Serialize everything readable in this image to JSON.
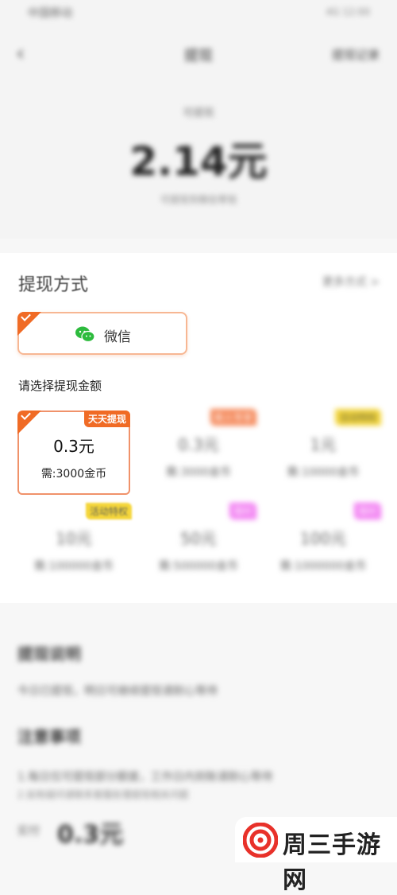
{
  "status_bar": {
    "left": "中国移动",
    "right": "4G 12:00"
  },
  "nav": {
    "back_icon": "chevron-left-icon",
    "title": "提现",
    "right": "提现记录"
  },
  "balance": {
    "label": "可提现",
    "amount": "2.14元",
    "note": "可提现到微信零钱"
  },
  "method_section": {
    "title": "提现方式",
    "right_link": "更多方式 >",
    "selected_method": "微信",
    "method_icon": "wechat-icon"
  },
  "amount_section": {
    "title": "请选择提现金额",
    "options": [
      {
        "amount": "0.3元",
        "need": "需:3000金币",
        "badge": "天天提现",
        "selected": true
      },
      {
        "amount": "0.3元",
        "need": "需:3000金币",
        "badge": "新人专享",
        "selected": false
      },
      {
        "amount": "1元",
        "need": "需:10000金币",
        "badge": "活动特权",
        "selected": false
      },
      {
        "amount": "10元",
        "need": "需:100000金币",
        "badge": "活动特权",
        "selected": false
      },
      {
        "amount": "50元",
        "need": "需:500000金币",
        "badge": "限时",
        "selected": false
      },
      {
        "amount": "100元",
        "need": "需:1000000金币",
        "badge": "限时",
        "selected": false
      }
    ]
  },
  "notes": {
    "title1": "提现说明",
    "text1": "今日已提现，明日可继续提现请耐心等待",
    "title2": "注意事项",
    "text2": "1.每日仅可提现部分额度，工作日内到账请耐心等待",
    "text3": "2.如有疑问请联系客服处理提现相关问题"
  },
  "bottom": {
    "prefix": "实付",
    "amount": "0.3元"
  },
  "watermark": {
    "text": "周三手游网"
  },
  "colors": {
    "accent": "#f06b25",
    "badge_yellow": "#f5d63a",
    "badge_pink": "#f27ef2",
    "badge_orange": "#f58a5c",
    "wechat_green": "#2dbb3d"
  }
}
